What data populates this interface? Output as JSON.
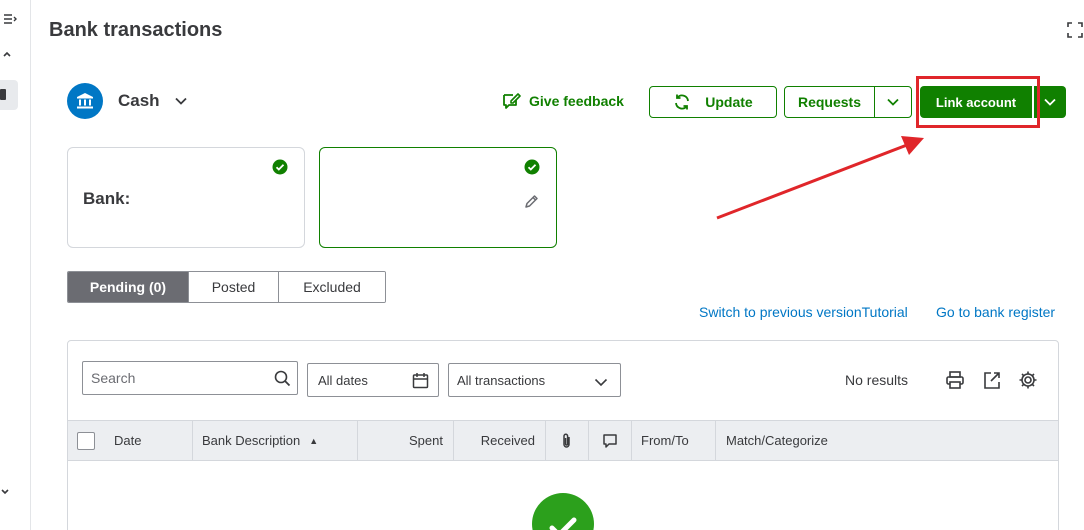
{
  "header": {
    "title": "Bank transactions"
  },
  "account": {
    "name": "Cash"
  },
  "actions": {
    "feedback_label": "Give feedback",
    "update_label": "Update",
    "requests_label": "Requests",
    "link_account_label": "Link account"
  },
  "cards": {
    "bank_label": "Bank:"
  },
  "tabs": [
    {
      "label": "Pending (0)",
      "active": true
    },
    {
      "label": "Posted",
      "active": false
    },
    {
      "label": "Excluded",
      "active": false
    }
  ],
  "links": {
    "switch_version": "Switch to previous versionTutorial",
    "bank_register": "Go to bank register"
  },
  "filters": {
    "search_placeholder": "Search",
    "date_value": "All dates",
    "type_value": "All transactions",
    "results_text": "No results"
  },
  "table": {
    "columns": {
      "date": "Date",
      "description": "Bank Description",
      "spent": "Spent",
      "received": "Received",
      "from_to": "From/To",
      "match": "Match/Categorize"
    }
  },
  "icons": [
    "menu-icon",
    "chevron-up-icon",
    "chevron-down-icon",
    "expand-icon",
    "bank-icon",
    "feedback-icon",
    "refresh-icon",
    "check-icon",
    "pencil-icon",
    "search-icon",
    "calendar-icon",
    "print-icon",
    "export-icon",
    "gear-icon",
    "paperclip-icon",
    "comment-icon"
  ],
  "colors": {
    "brand_green": "#108000",
    "link_blue": "#0077c5",
    "annotation_red": "#e0262a",
    "tab_active": "#6b6c72",
    "success_green": "#2ca01c"
  }
}
